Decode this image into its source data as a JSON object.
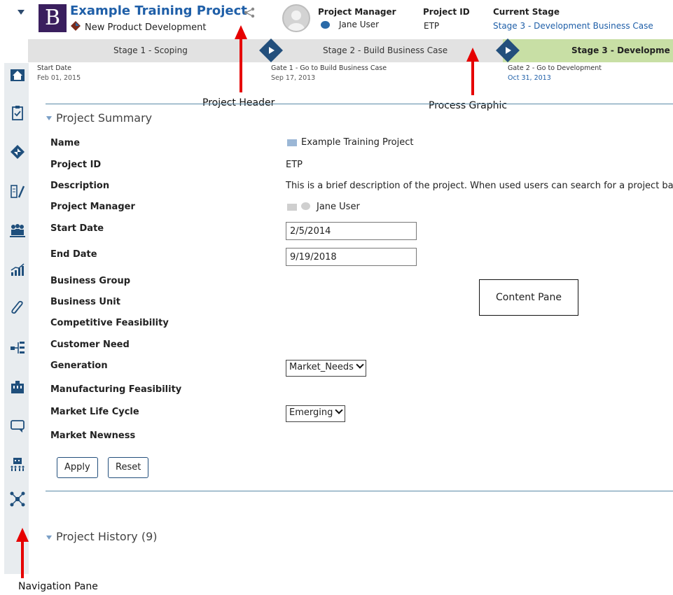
{
  "header": {
    "logo_letter": "B",
    "project_title": "Example Training Project",
    "process_name": "New Product Development",
    "project_manager_label": "Project Manager",
    "project_manager_value": "Jane User",
    "project_id_label": "Project ID",
    "project_id_value": "ETP",
    "current_stage_label": "Current Stage",
    "current_stage_value": "Stage 3 - Development Business Case"
  },
  "process": {
    "stages": [
      "Stage 1 - Scoping",
      "Stage 2 - Build Business Case",
      "Stage 3 - Developme"
    ],
    "start_label": "Start Date",
    "start_date": "Feb 01, 2015",
    "gates": [
      {
        "label": "Gate 1 - Go to Build Business Case",
        "date": "Sep 17, 2013"
      },
      {
        "label": "Gate 2 - Go to Development",
        "date": "Oct 31, 2013"
      }
    ]
  },
  "annotations": {
    "project_header": "Project Header",
    "process_graphic": "Process Graphic",
    "content_pane": "Content Pane",
    "navigation_pane": "Navigation Pane"
  },
  "summary": {
    "title": "Project Summary",
    "fields": [
      {
        "label": "Name",
        "value": "Example Training Project"
      },
      {
        "label": "Project ID",
        "value": "ETP"
      },
      {
        "label": "Description",
        "value": "This is a brief description of the project. When used users can search for a project ba"
      },
      {
        "label": "Project Manager",
        "value": "Jane User"
      },
      {
        "label": "Start Date",
        "value": "2/5/2014"
      },
      {
        "label": "End Date",
        "value": "9/19/2018"
      },
      {
        "label": "Business Group",
        "value": ""
      },
      {
        "label": "Business Unit",
        "value": ""
      },
      {
        "label": "Competitive Feasibility",
        "value": ""
      },
      {
        "label": "Customer Need",
        "value": ""
      },
      {
        "label": "Generation",
        "value": "Market_Needs"
      },
      {
        "label": "Manufacturing Feasibility",
        "value": ""
      },
      {
        "label": "Market Life Cycle",
        "value": "Emerging"
      },
      {
        "label": "Market Newness",
        "value": ""
      }
    ],
    "apply_label": "Apply",
    "reset_label": "Reset"
  },
  "history": {
    "title": "Project History (9)"
  },
  "icons": {
    "nav": [
      "home-icon",
      "clipboard-check-icon",
      "gate-diamond-icon",
      "edit-list-icon",
      "team-icon",
      "chart-icon",
      "paperclip-icon",
      "hierarchy-icon",
      "building-icon",
      "comment-icon",
      "calendar-people-icon",
      "network-icon"
    ]
  },
  "colors": {
    "accent": "#1f5fa8",
    "stage_current": "#c8dfa5",
    "gate_diamond": "#234f7c",
    "annotation_arrow": "#e60000"
  }
}
